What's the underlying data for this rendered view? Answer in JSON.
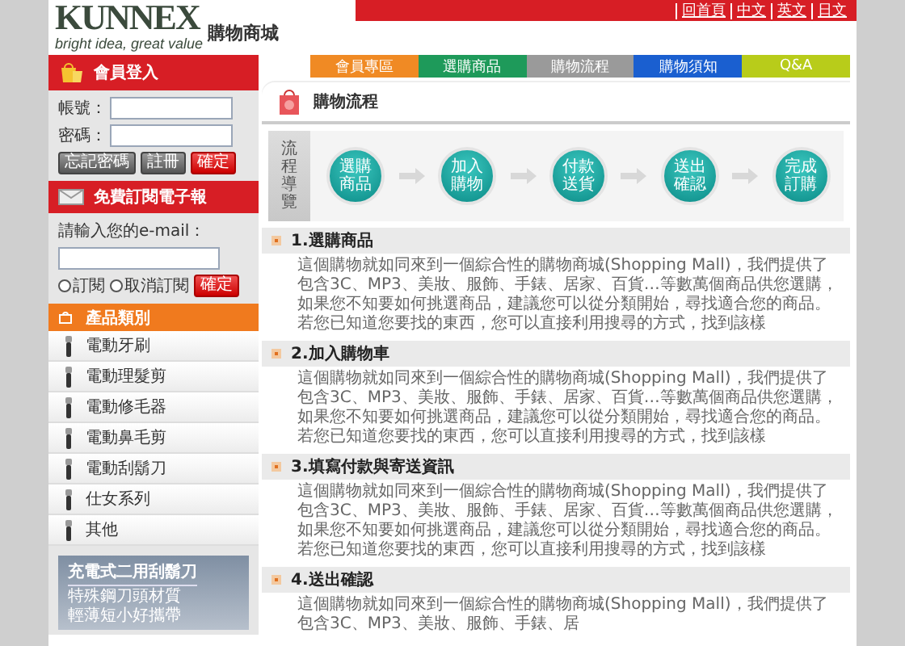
{
  "header": {
    "logo": {
      "brand": "KUNNEX",
      "tagline": "bright idea, great value",
      "store": "購物商城"
    },
    "lang_links": [
      "回首頁",
      "中文",
      "英文",
      "日文"
    ]
  },
  "nav_tabs": [
    {
      "label": "會員專區",
      "color": "#f08a24"
    },
    {
      "label": "選購商品",
      "color": "#1e9a5a"
    },
    {
      "label": "購物流程",
      "color": "#9a9a9a"
    },
    {
      "label": "購物須知",
      "color": "#1a5fd0"
    },
    {
      "label": "Q&A",
      "color": "#b8cc1a"
    }
  ],
  "login": {
    "title": "會員登入",
    "fields": [
      {
        "label": "帳號："
      },
      {
        "label": "密碼："
      }
    ],
    "buttons": [
      {
        "label": "忘記密碼",
        "kind": "gray"
      },
      {
        "label": "註冊",
        "kind": "gray"
      },
      {
        "label": "確定",
        "kind": "red"
      }
    ]
  },
  "newsletter": {
    "title": "免費訂閱電子報",
    "prompt": "請輸入您的e-mail：",
    "options": [
      {
        "label": "訂閱",
        "selected": false
      },
      {
        "label": "取消訂閱",
        "selected": false
      }
    ],
    "button": "確定"
  },
  "categories": {
    "title": "產品類別",
    "items": [
      "電動牙刷",
      "電動理髮剪",
      "電動修毛器",
      "電動鼻毛剪",
      "電動刮鬍刀",
      "仕女系列",
      "其他"
    ]
  },
  "promo": {
    "title": "充電式二用刮鬍刀",
    "lines": [
      "特殊鋼刀頭材質",
      "輕薄短小好攜帶"
    ]
  },
  "main": {
    "title": "購物流程",
    "flow": {
      "label": "流程導覽",
      "steps": [
        "選購商品",
        "加入購物",
        "付款送貨",
        "送出確認",
        "完成訂購"
      ]
    },
    "sections": [
      {
        "heading": "1.選購商品",
        "body": "這個購物就如同來到一個綜合性的購物商城(Shopping Mall)，我們提供了包含3C、MP3、美妝、服飾、手錶、居家、百貨…等數萬個商品供您選購，如果您不知要如何挑選商品，建議您可以從分類開始，尋找適合您的商品。若您已知道您要找的東西，您可以直接利用搜尋的方式，找到該樣"
      },
      {
        "heading": "2.加入購物車",
        "body": "這個購物就如同來到一個綜合性的購物商城(Shopping Mall)，我們提供了包含3C、MP3、美妝、服飾、手錶、居家、百貨…等數萬個商品供您選購，如果您不知要如何挑選商品，建議您可以從分類開始，尋找適合您的商品。若您已知道您要找的東西，您可以直接利用搜尋的方式，找到該樣"
      },
      {
        "heading": "3.填寫付款與寄送資訊",
        "body": "這個購物就如同來到一個綜合性的購物商城(Shopping Mall)，我們提供了包含3C、MP3、美妝、服飾、手錶、居家、百貨…等數萬個商品供您選購，如果您不知要如何挑選商品，建議您可以從分類開始，尋找適合您的商品。若您已知道您要找的東西，您可以直接利用搜尋的方式，找到該樣"
      },
      {
        "heading": "4.送出確認",
        "body": "這個購物就如同來到一個綜合性的購物商城(Shopping Mall)，我們提供了包含3C、MP3、美妝、服飾、手錶、居"
      }
    ]
  }
}
